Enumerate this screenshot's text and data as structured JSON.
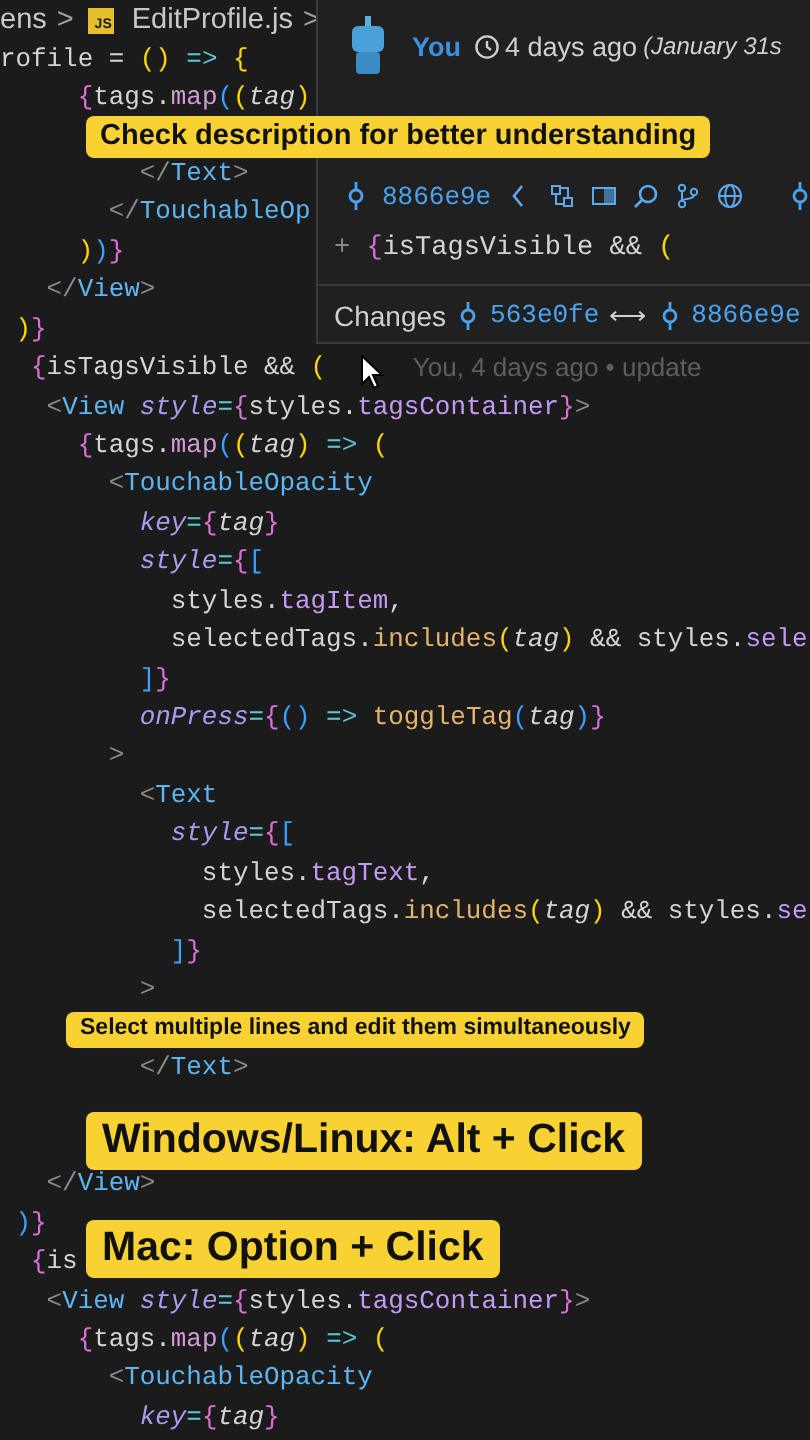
{
  "breadcrumb": [
    {
      "kind": "folder",
      "label": "ens"
    },
    {
      "kind": "separator",
      "label": ">"
    },
    {
      "kind": "file",
      "label": "EditProfile.js",
      "badge": "JS"
    },
    {
      "kind": "separator",
      "label": ">"
    }
  ],
  "editor": {
    "lines": [
      {
        "kind": "code",
        "tokens": [
          {
            "text": "rofile ",
            "kind": "plain"
          },
          {
            "text": "= ",
            "kind": "plain"
          },
          {
            "text": "()",
            "kind": "b1"
          },
          {
            "text": " => ",
            "kind": "op"
          },
          {
            "text": "{",
            "kind": "b1"
          }
        ]
      },
      {
        "kind": "code",
        "tokens": [
          {
            "text": "     {",
            "kind": "b2"
          },
          {
            "text": "tags.",
            "kind": "plain"
          },
          {
            "text": "map",
            "kind": "method"
          },
          {
            "text": "(",
            "kind": "b3"
          },
          {
            "text": "(",
            "kind": "b1"
          },
          {
            "text": "tag",
            "kind": "param"
          },
          {
            "text": ")",
            "kind": "b1"
          }
        ]
      },
      {
        "kind": "code",
        "tokens": [
          {
            "text": "         </",
            "kind": "punct"
          },
          {
            "text": "Text",
            "kind": "tag"
          },
          {
            "text": ">",
            "kind": "punct"
          }
        ]
      },
      {
        "kind": "code",
        "tokens": [
          {
            "text": "       </",
            "kind": "punct"
          },
          {
            "text": "TouchableOp",
            "kind": "tag"
          }
        ]
      },
      {
        "kind": "code",
        "tokens": [
          {
            "text": "     )",
            "kind": "b1"
          },
          {
            "text": ")",
            "kind": "b3"
          },
          {
            "text": "}",
            "kind": "b2"
          }
        ]
      },
      {
        "kind": "code",
        "tokens": [
          {
            "text": "   </",
            "kind": "punct"
          },
          {
            "text": "View",
            "kind": "tag"
          },
          {
            "text": ">",
            "kind": "punct"
          }
        ]
      },
      {
        "kind": "code",
        "tokens": [
          {
            "text": " )",
            "kind": "b1"
          },
          {
            "text": "}",
            "kind": "b2"
          }
        ]
      },
      {
        "kind": "code",
        "tokens": [
          {
            "text": "  {",
            "kind": "b2"
          },
          {
            "text": "isTagsVisible && ",
            "kind": "plain"
          },
          {
            "text": "(",
            "kind": "b1"
          }
        ],
        "blame": "You, 4 days ago • update"
      },
      {
        "kind": "code",
        "tokens": [
          {
            "text": "   <",
            "kind": "punct"
          },
          {
            "text": "View ",
            "kind": "tag"
          },
          {
            "text": "style",
            "kind": "attr"
          },
          {
            "text": "=",
            "kind": "op"
          },
          {
            "text": "{",
            "kind": "b2"
          },
          {
            "text": "styles.",
            "kind": "plain"
          },
          {
            "text": "tagsContainer",
            "kind": "prop"
          },
          {
            "text": "}",
            "kind": "b2"
          },
          {
            "text": ">",
            "kind": "punct"
          }
        ]
      },
      {
        "kind": "code",
        "tokens": [
          {
            "text": "     {",
            "kind": "b2"
          },
          {
            "text": "tags.",
            "kind": "plain"
          },
          {
            "text": "map",
            "kind": "method"
          },
          {
            "text": "(",
            "kind": "b3"
          },
          {
            "text": "(",
            "kind": "b1"
          },
          {
            "text": "tag",
            "kind": "param"
          },
          {
            "text": ")",
            "kind": "b1"
          },
          {
            "text": " => ",
            "kind": "op"
          },
          {
            "text": "(",
            "kind": "b1"
          }
        ]
      },
      {
        "kind": "code",
        "tokens": [
          {
            "text": "       <",
            "kind": "punct"
          },
          {
            "text": "TouchableOpacity",
            "kind": "tag"
          }
        ]
      },
      {
        "kind": "code",
        "tokens": [
          {
            "text": "         key",
            "kind": "attr"
          },
          {
            "text": "=",
            "kind": "op"
          },
          {
            "text": "{",
            "kind": "b2"
          },
          {
            "text": "tag",
            "kind": "param"
          },
          {
            "text": "}",
            "kind": "b2"
          }
        ]
      },
      {
        "kind": "code",
        "tokens": [
          {
            "text": "         style",
            "kind": "attr"
          },
          {
            "text": "=",
            "kind": "op"
          },
          {
            "text": "{",
            "kind": "b2"
          },
          {
            "text": "[",
            "kind": "b3"
          }
        ]
      },
      {
        "kind": "code",
        "tokens": [
          {
            "text": "           styles.",
            "kind": "plain"
          },
          {
            "text": "tagItem",
            "kind": "prop"
          },
          {
            "text": ",",
            "kind": "plain"
          }
        ]
      },
      {
        "kind": "code",
        "tokens": [
          {
            "text": "           selectedTags.",
            "kind": "plain"
          },
          {
            "text": "includes",
            "kind": "call"
          },
          {
            "text": "(",
            "kind": "b1"
          },
          {
            "text": "tag",
            "kind": "param"
          },
          {
            "text": ")",
            "kind": "b1"
          },
          {
            "text": " && styles.",
            "kind": "plain"
          },
          {
            "text": "sele",
            "kind": "prop"
          }
        ]
      },
      {
        "kind": "code",
        "tokens": [
          {
            "text": "         ]",
            "kind": "b3"
          },
          {
            "text": "}",
            "kind": "b2"
          }
        ]
      },
      {
        "kind": "code",
        "tokens": [
          {
            "text": "         onPress",
            "kind": "attr"
          },
          {
            "text": "=",
            "kind": "op"
          },
          {
            "text": "{",
            "kind": "b2"
          },
          {
            "text": "()",
            "kind": "b3"
          },
          {
            "text": " => ",
            "kind": "op"
          },
          {
            "text": "toggleTag",
            "kind": "call"
          },
          {
            "text": "(",
            "kind": "b3"
          },
          {
            "text": "tag",
            "kind": "param"
          },
          {
            "text": ")",
            "kind": "b3"
          },
          {
            "text": "}",
            "kind": "b2"
          }
        ]
      },
      {
        "kind": "code",
        "tokens": [
          {
            "text": "       >",
            "kind": "punct"
          }
        ]
      },
      {
        "kind": "code",
        "tokens": [
          {
            "text": "         <",
            "kind": "punct"
          },
          {
            "text": "Text",
            "kind": "tag"
          }
        ]
      },
      {
        "kind": "code",
        "tokens": [
          {
            "text": "           style",
            "kind": "attr"
          },
          {
            "text": "=",
            "kind": "op"
          },
          {
            "text": "{",
            "kind": "b2"
          },
          {
            "text": "[",
            "kind": "b3"
          }
        ]
      },
      {
        "kind": "code",
        "tokens": [
          {
            "text": "             styles.",
            "kind": "plain"
          },
          {
            "text": "tagText",
            "kind": "prop"
          },
          {
            "text": ",",
            "kind": "plain"
          }
        ]
      },
      {
        "kind": "code",
        "tokens": [
          {
            "text": "             selectedTags.",
            "kind": "plain"
          },
          {
            "text": "includes",
            "kind": "call"
          },
          {
            "text": "(",
            "kind": "b1"
          },
          {
            "text": "tag",
            "kind": "param"
          },
          {
            "text": ")",
            "kind": "b1"
          },
          {
            "text": " && styles.",
            "kind": "plain"
          },
          {
            "text": "se",
            "kind": "prop"
          }
        ]
      },
      {
        "kind": "code",
        "tokens": [
          {
            "text": "           ]",
            "kind": "b3"
          },
          {
            "text": "}",
            "kind": "b2"
          }
        ]
      },
      {
        "kind": "code",
        "tokens": [
          {
            "text": "         >",
            "kind": "punct"
          }
        ]
      },
      {
        "kind": "blank"
      },
      {
        "kind": "code",
        "tokens": [
          {
            "text": "         </",
            "kind": "punct"
          },
          {
            "text": "Text",
            "kind": "tag"
          },
          {
            "text": ">",
            "kind": "punct"
          }
        ]
      },
      {
        "kind": "blank"
      },
      {
        "kind": "blank"
      },
      {
        "kind": "code",
        "tokens": [
          {
            "text": "   </",
            "kind": "punct"
          },
          {
            "text": "View",
            "kind": "tag"
          },
          {
            "text": ">",
            "kind": "punct"
          }
        ]
      },
      {
        "kind": "code",
        "tokens": [
          {
            "text": " )",
            "kind": "b3"
          },
          {
            "text": "}",
            "kind": "b2"
          }
        ]
      },
      {
        "kind": "code",
        "tokens": [
          {
            "text": "  {",
            "kind": "b2"
          },
          {
            "text": "is",
            "kind": "plain"
          }
        ]
      },
      {
        "kind": "code",
        "tokens": [
          {
            "text": "   <",
            "kind": "punct"
          },
          {
            "text": "View ",
            "kind": "tag"
          },
          {
            "text": "style",
            "kind": "attr"
          },
          {
            "text": "=",
            "kind": "op"
          },
          {
            "text": "{",
            "kind": "b2"
          },
          {
            "text": "styles.",
            "kind": "plain"
          },
          {
            "text": "tagsContainer",
            "kind": "prop"
          },
          {
            "text": "}",
            "kind": "b2"
          },
          {
            "text": ">",
            "kind": "punct"
          }
        ]
      },
      {
        "kind": "code",
        "tokens": [
          {
            "text": "     {",
            "kind": "b2"
          },
          {
            "text": "tags.",
            "kind": "plain"
          },
          {
            "text": "map",
            "kind": "method"
          },
          {
            "text": "(",
            "kind": "b3"
          },
          {
            "text": "(",
            "kind": "b1"
          },
          {
            "text": "tag",
            "kind": "param"
          },
          {
            "text": ")",
            "kind": "b1"
          },
          {
            "text": " => ",
            "kind": "op"
          },
          {
            "text": "(",
            "kind": "b1"
          }
        ]
      },
      {
        "kind": "code",
        "tokens": [
          {
            "text": "       <",
            "kind": "punct"
          },
          {
            "text": "TouchableOpacity",
            "kind": "tag"
          }
        ]
      },
      {
        "kind": "code",
        "tokens": [
          {
            "text": "         key",
            "kind": "attr"
          },
          {
            "text": "=",
            "kind": "op"
          },
          {
            "text": "{",
            "kind": "b2"
          },
          {
            "text": "tag",
            "kind": "param"
          },
          {
            "text": "}",
            "kind": "b2"
          }
        ]
      }
    ]
  },
  "blame_hover": {
    "author": "You",
    "time": "4 days ago",
    "date": "(January 31s",
    "commit": "8866e9e",
    "diff_line": [
      {
        "text": "+ ",
        "kind": "punct"
      },
      {
        "text": "{",
        "kind": "b2"
      },
      {
        "text": "isTagsVisible && ",
        "kind": "plain"
      },
      {
        "text": "(",
        "kind": "b1"
      }
    ],
    "changes_label": "Changes",
    "from_commit": "563e0fe",
    "arrow": "⟷",
    "to_commit": "8866e9e"
  },
  "captions": [
    {
      "text": "Check description for better understanding"
    },
    {
      "text": "Select multiple lines and edit them simultaneously"
    },
    {
      "text": "Windows/Linux: Alt + Click"
    },
    {
      "text": "Mac: Option + Click"
    }
  ]
}
